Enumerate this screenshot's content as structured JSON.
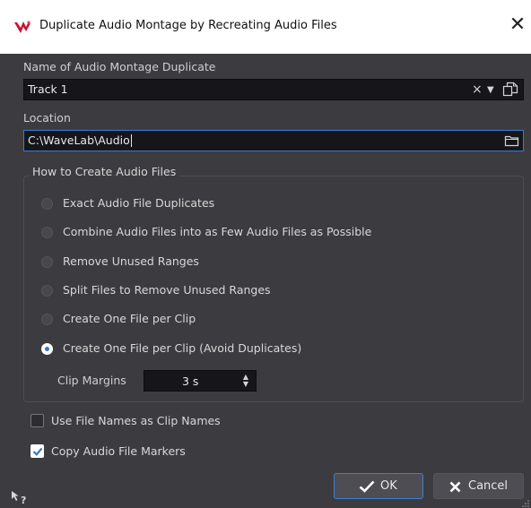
{
  "window": {
    "title": "Duplicate Audio Montage by Recreating Audio Files",
    "close_glyph": "✕",
    "logo_icon": "wavelab-logo-icon"
  },
  "name_field": {
    "label": "Name of Audio Montage Duplicate",
    "value": "Track 1",
    "icons": [
      "clear-icon",
      "dropdown-arrow-icon",
      "copy-icon"
    ],
    "clear_glyph": "×",
    "dropdown_glyph": "▼"
  },
  "location_field": {
    "label": "Location",
    "value": "C:\\WaveLab\\Audio",
    "icon": "folder-icon"
  },
  "group": {
    "title": "How to Create Audio Files",
    "options": [
      {
        "label": "Exact Audio File Duplicates",
        "selected": false
      },
      {
        "label": "Combine Audio Files into as Few Audio Files as Possible",
        "selected": false
      },
      {
        "label": "Remove Unused Ranges",
        "selected": false
      },
      {
        "label": "Split Files to Remove Unused Ranges",
        "selected": false
      },
      {
        "label": "Create One File per Clip",
        "selected": false
      },
      {
        "label": "Create One File per Clip (Avoid Duplicates)",
        "selected": true
      }
    ],
    "clip_margins": {
      "label": "Clip Margins",
      "value": "3 s",
      "up_glyph": "▲",
      "down_glyph": "▼"
    }
  },
  "checkboxes": [
    {
      "label": "Use File Names as Clip Names",
      "checked": false
    },
    {
      "label": "Copy Audio File Markers",
      "checked": true
    }
  ],
  "buttons": {
    "ok": {
      "label": "OK",
      "icon": "checkmark-icon"
    },
    "cancel": {
      "label": "Cancel",
      "icon": "x-icon"
    }
  },
  "footer": {
    "help_icon": "whats-this-help-icon",
    "grip_icon": "resize-grip-icon"
  },
  "colors": {
    "background": "#3c3c40",
    "titlebar": "#ffffff",
    "field": "#16161a",
    "focus_border": "#3a7bd5",
    "accent": "#3a76c4",
    "logo_red": "#c8102e"
  }
}
